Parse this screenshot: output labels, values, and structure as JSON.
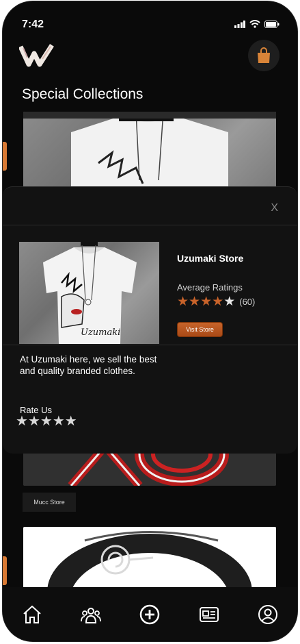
{
  "status_bar": {
    "time": "7:42"
  },
  "header": {
    "logo_icon": "w-logo-icon",
    "cart_icon": "shopping-bag-icon"
  },
  "main": {
    "section_title": "Special Collections",
    "cards": [
      {
        "image": "white-tshirt-image"
      },
      {
        "image": "red-symbol-image",
        "store_label": "Mucc Store"
      },
      {
        "image": "black-ring-image"
      }
    ]
  },
  "modal": {
    "close_label": "X",
    "store_name": "Uzumaki Store",
    "ratings_label": "Average Ratings",
    "rating_value": 4,
    "rating_max": 5,
    "rating_count": "(60)",
    "visit_button": "Visit Store",
    "description": "At Uzumaki here, we sell the best and quality branded clothes.",
    "rate_label": "Rate Us",
    "accent_color": "#c9632a"
  },
  "bottom_nav": {
    "items": [
      {
        "icon": "home-icon"
      },
      {
        "icon": "community-icon"
      },
      {
        "icon": "add-circle-icon"
      },
      {
        "icon": "news-icon"
      },
      {
        "icon": "profile-icon"
      }
    ]
  }
}
